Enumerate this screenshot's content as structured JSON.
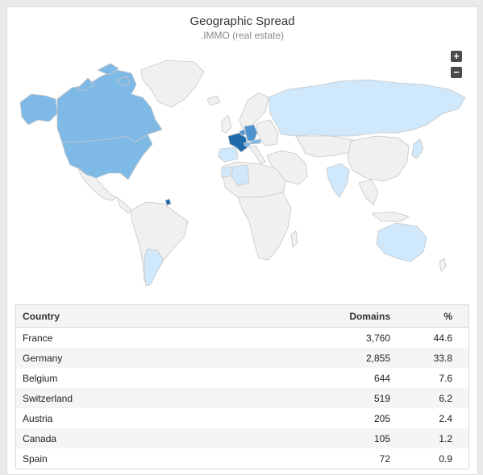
{
  "widget": {
    "title": "Geographic Spread",
    "subtitle": ".IMMO (real estate)"
  },
  "map": {
    "zoom_in_label": "+",
    "zoom_out_label": "−",
    "colors": {
      "ocean": "#ffffff",
      "no_data": "#f0f0f0",
      "border": "#c7c7c7",
      "level_1": "#cfe8fb",
      "level_2": "#a8d4f5",
      "level_3": "#7fb9e6",
      "level_4": "#4f93cf",
      "level_5": "#1f6aab"
    }
  },
  "table": {
    "headers": {
      "country": "Country",
      "domains": "Domains",
      "percent": "%"
    },
    "rows": [
      {
        "country": "France",
        "domains": "3,760",
        "percent": "44.6"
      },
      {
        "country": "Germany",
        "domains": "2,855",
        "percent": "33.8"
      },
      {
        "country": "Belgium",
        "domains": "644",
        "percent": "7.6"
      },
      {
        "country": "Switzerland",
        "domains": "519",
        "percent": "6.2"
      },
      {
        "country": "Austria",
        "domains": "205",
        "percent": "2.4"
      },
      {
        "country": "Canada",
        "domains": "105",
        "percent": "1.2"
      },
      {
        "country": "Spain",
        "domains": "72",
        "percent": "0.9"
      }
    ]
  }
}
